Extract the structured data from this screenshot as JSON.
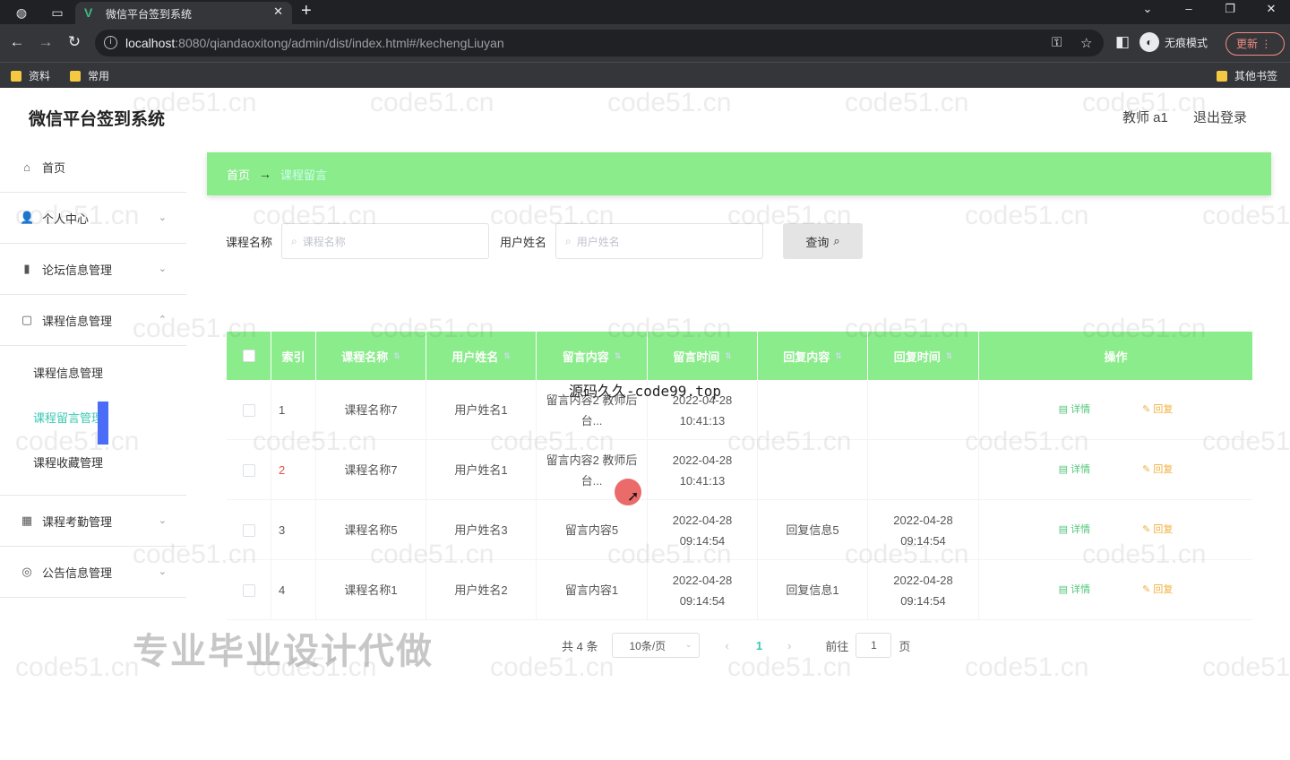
{
  "browser": {
    "tab_title": "微信平台签到系统",
    "url_host": "localhost",
    "url_rest": ":8080/qiandaoxitong/admin/dist/index.html#/kechengLiuyan",
    "incognito_label": "无痕模式",
    "update_label": "更新",
    "bookmarks": [
      "资料",
      "常用"
    ],
    "other_bookmarks": "其他书签"
  },
  "header": {
    "brand": "微信平台签到系统",
    "user": "教师 a1",
    "logout": "退出登录"
  },
  "sidebar": {
    "home": "首页",
    "personal": "个人中心",
    "forum": "论坛信息管理",
    "course": "课程信息管理",
    "course_sub": [
      "课程信息管理",
      "课程留言管理",
      "课程收藏管理"
    ],
    "attendance": "课程考勤管理",
    "notice": "公告信息管理"
  },
  "breadcrumb": {
    "home": "首页",
    "separator": "→",
    "current": "课程留言"
  },
  "search": {
    "course_label": "课程名称",
    "course_placeholder": "课程名称",
    "user_label": "用户姓名",
    "user_placeholder": "用户姓名",
    "query_button": "查询"
  },
  "table": {
    "headers": [
      "索引",
      "课程名称",
      "用户姓名",
      "留言内容",
      "留言时间",
      "回复内容",
      "回复时间",
      "操作"
    ],
    "rows": [
      {
        "index": "1",
        "course": "课程名称7",
        "user": "用户姓名1",
        "message": "留言内容2 教师后台...",
        "msg_time": "2022-04-28 10:41:13",
        "reply": "",
        "reply_time": ""
      },
      {
        "index": "2",
        "course": "课程名称7",
        "user": "用户姓名1",
        "message": "留言内容2 教师后台...",
        "msg_time": "2022-04-28 10:41:13",
        "reply": "",
        "reply_time": ""
      },
      {
        "index": "3",
        "course": "课程名称5",
        "user": "用户姓名3",
        "message": "留言内容5",
        "msg_time": "2022-04-28 09:14:54",
        "reply": "回复信息5",
        "reply_time": "2022-04-28 09:14:54"
      },
      {
        "index": "4",
        "course": "课程名称1",
        "user": "用户姓名2",
        "message": "留言内容1",
        "msg_time": "2022-04-28 09:14:54",
        "reply": "回复信息1",
        "reply_time": "2022-04-28 09:14:54"
      }
    ],
    "detail_label": "详情",
    "reply_label": "回复"
  },
  "pagination": {
    "total": "共 4 条",
    "page_size": "10条/页",
    "current_page": "1",
    "goto_label": "前往",
    "goto_value": "1",
    "page_suffix": "页"
  },
  "overlays": {
    "top_text": "源码久久-code99.top",
    "big_text": "专业毕业设计代做",
    "watermark": "code51.cn"
  },
  "colors": {
    "accent_green": "#8aec8a",
    "active_teal": "#3cc8b4",
    "detail_green": "#52c47a",
    "reply_orange": "#f0b040",
    "index_red": "#e4534a"
  }
}
